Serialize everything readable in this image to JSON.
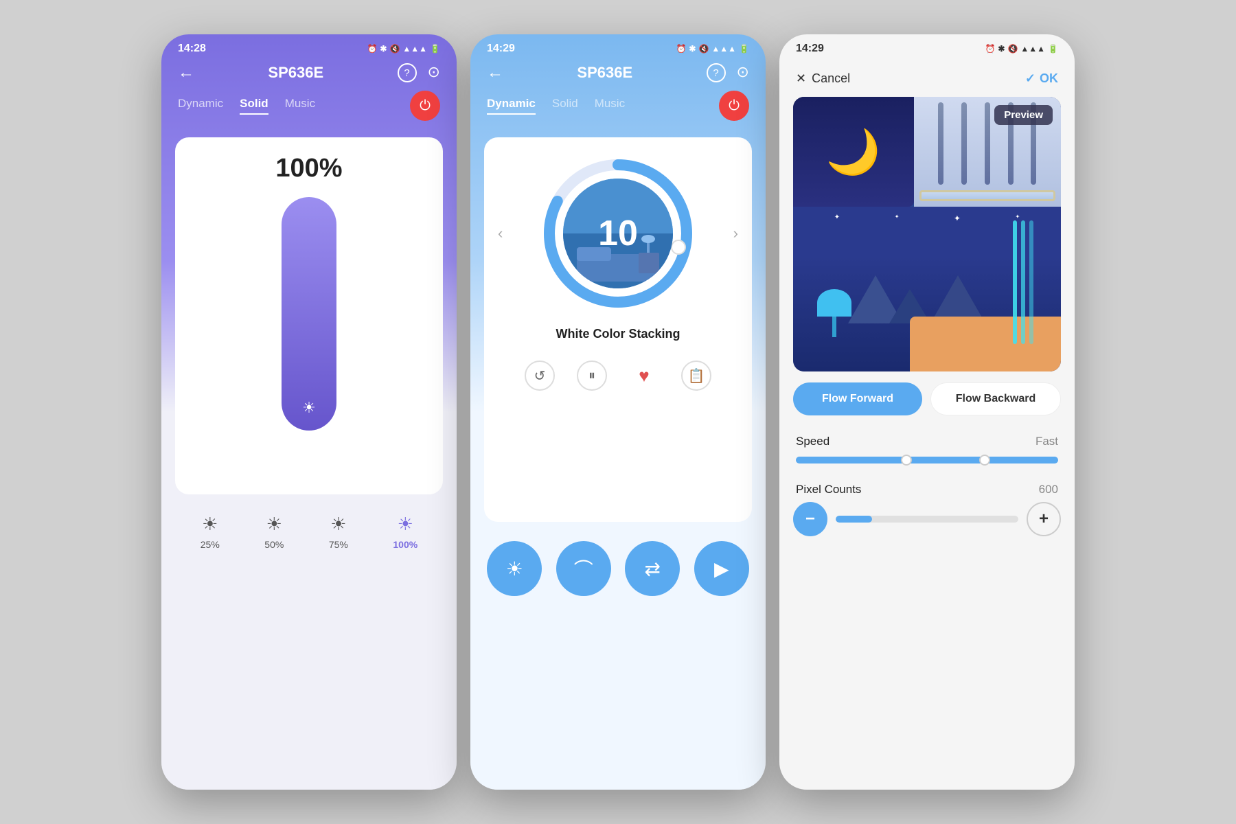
{
  "phones": {
    "phone1": {
      "statusBar": {
        "time": "14:28",
        "icons": "⏰ ✱ 🔇 📶 📶 🔋"
      },
      "header": {
        "backIcon": "←",
        "title": "SP636E",
        "helpIcon": "?",
        "settingsIcon": "⊙"
      },
      "tabs": [
        "Dynamic",
        "Solid",
        "Music"
      ],
      "activeTab": "Solid",
      "powerButtonLabel": "⏻",
      "brightness": {
        "percent": "100%"
      },
      "presets": [
        {
          "label": "25%",
          "active": false
        },
        {
          "label": "50%",
          "active": false
        },
        {
          "label": "75%",
          "active": false
        },
        {
          "label": "100%",
          "active": true
        }
      ]
    },
    "phone2": {
      "statusBar": {
        "time": "14:29",
        "icons": "⏰ ✱ 🔇 📶 📶 🔋"
      },
      "header": {
        "backIcon": "←",
        "title": "SP636E",
        "helpIcon": "?",
        "settingsIcon": "⊙"
      },
      "tabs": [
        "Dynamic",
        "Solid",
        "Music"
      ],
      "activeTab": "Dynamic",
      "powerButtonLabel": "⏻",
      "timerNumber": "10",
      "effectName": "White Color Stacking",
      "prevArrow": "‹",
      "nextArrow": "›",
      "actionIcons": {
        "loop": "↺",
        "pause": "⏸",
        "heart": "♥",
        "list": "≡"
      },
      "bottomControls": {
        "brightness": "☀",
        "arc": "↑",
        "swap": "⇄",
        "play": "▶"
      }
    },
    "phone3": {
      "statusBar": {
        "time": "14:29",
        "icons": "⏰ ✱ 🔇 📶 📶 🔋"
      },
      "header": {
        "cancelIcon": "✕",
        "cancelLabel": "Cancel",
        "okIcon": "✓",
        "okLabel": "OK"
      },
      "previewBadge": "Preview",
      "directionButtons": {
        "forward": "Flow Forward",
        "backward": "Flow Backward"
      },
      "speed": {
        "label": "Speed",
        "value": "Fast"
      },
      "pixelCounts": {
        "label": "Pixel Counts",
        "value": "600",
        "minusIcon": "−",
        "plusIcon": "+"
      }
    }
  }
}
